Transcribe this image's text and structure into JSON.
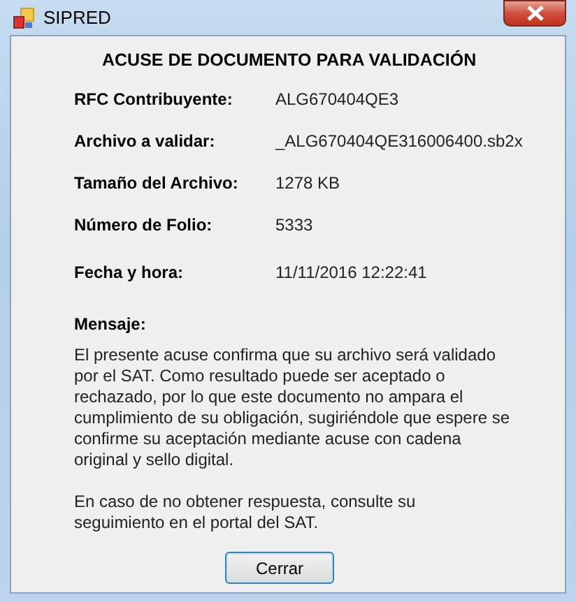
{
  "window": {
    "title": "SIPRED"
  },
  "heading": "ACUSE DE DOCUMENTO PARA VALIDACIÓN",
  "fields": [
    {
      "label": "RFC Contribuyente:",
      "value": "ALG670404QE3"
    },
    {
      "label": "Archivo a validar:",
      "value": "_ALG670404QE316006400.sb2x"
    },
    {
      "label": "Tamaño del Archivo:",
      "value": "1278 KB"
    },
    {
      "label": "Número de Folio:",
      "value": "5333"
    },
    {
      "label": "Fecha y hora:",
      "value": "11/11/2016 12:22:41"
    }
  ],
  "message": {
    "label": "Mensaje:",
    "paragraphs": [
      "El presente acuse confirma que su archivo será validado por el SAT. Como resultado puede ser aceptado o rechazado, por lo que este documento no ampara el cumplimiento de su obligación, sugiriéndole que espere se confirme su aceptación mediante acuse con cadena original y sello digital.",
      "En caso de no obtener respuesta, consulte su seguimiento en el portal del SAT."
    ]
  },
  "buttons": [
    "Cerrar"
  ]
}
